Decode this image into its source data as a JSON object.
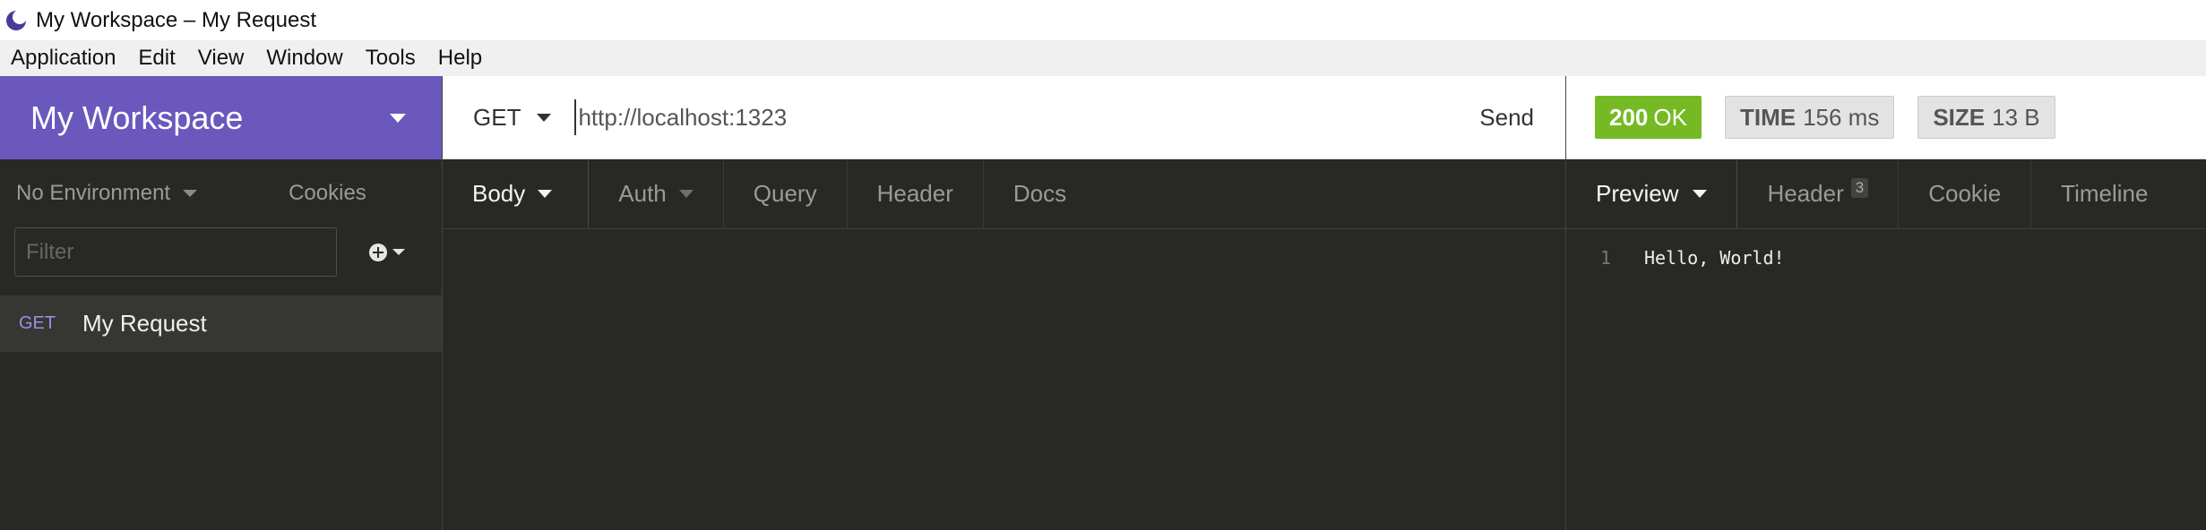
{
  "window": {
    "title": "My Workspace – My Request",
    "app_icon": "insomnia-moon-icon"
  },
  "menu": [
    "Application",
    "Edit",
    "View",
    "Window",
    "Tools",
    "Help"
  ],
  "sidebar": {
    "workspace_name": "My Workspace",
    "environment": "No Environment",
    "cookies_label": "Cookies",
    "filter_placeholder": "Filter",
    "requests": [
      {
        "method": "GET",
        "name": "My Request"
      }
    ]
  },
  "request": {
    "method": "GET",
    "url": "http://localhost:1323",
    "send_label": "Send",
    "tabs": [
      {
        "label": "Body"
      },
      {
        "label": "Auth"
      },
      {
        "label": "Query"
      },
      {
        "label": "Header"
      },
      {
        "label": "Docs"
      }
    ]
  },
  "response": {
    "status_code": "200",
    "status_text": "OK",
    "time_label": "TIME",
    "time_value": "156 ms",
    "size_label": "SIZE",
    "size_value": "13 B",
    "tabs": [
      {
        "label": "Preview"
      },
      {
        "label": "Header",
        "count": "3"
      },
      {
        "label": "Cookie"
      },
      {
        "label": "Timeline"
      }
    ],
    "body_lines": [
      {
        "n": "1",
        "text": "Hello, World!"
      }
    ]
  },
  "colors": {
    "workspace_header": "#6b58bd",
    "status_ok": "#75ba24",
    "method_get": "#a28be6",
    "background": "#282925"
  }
}
